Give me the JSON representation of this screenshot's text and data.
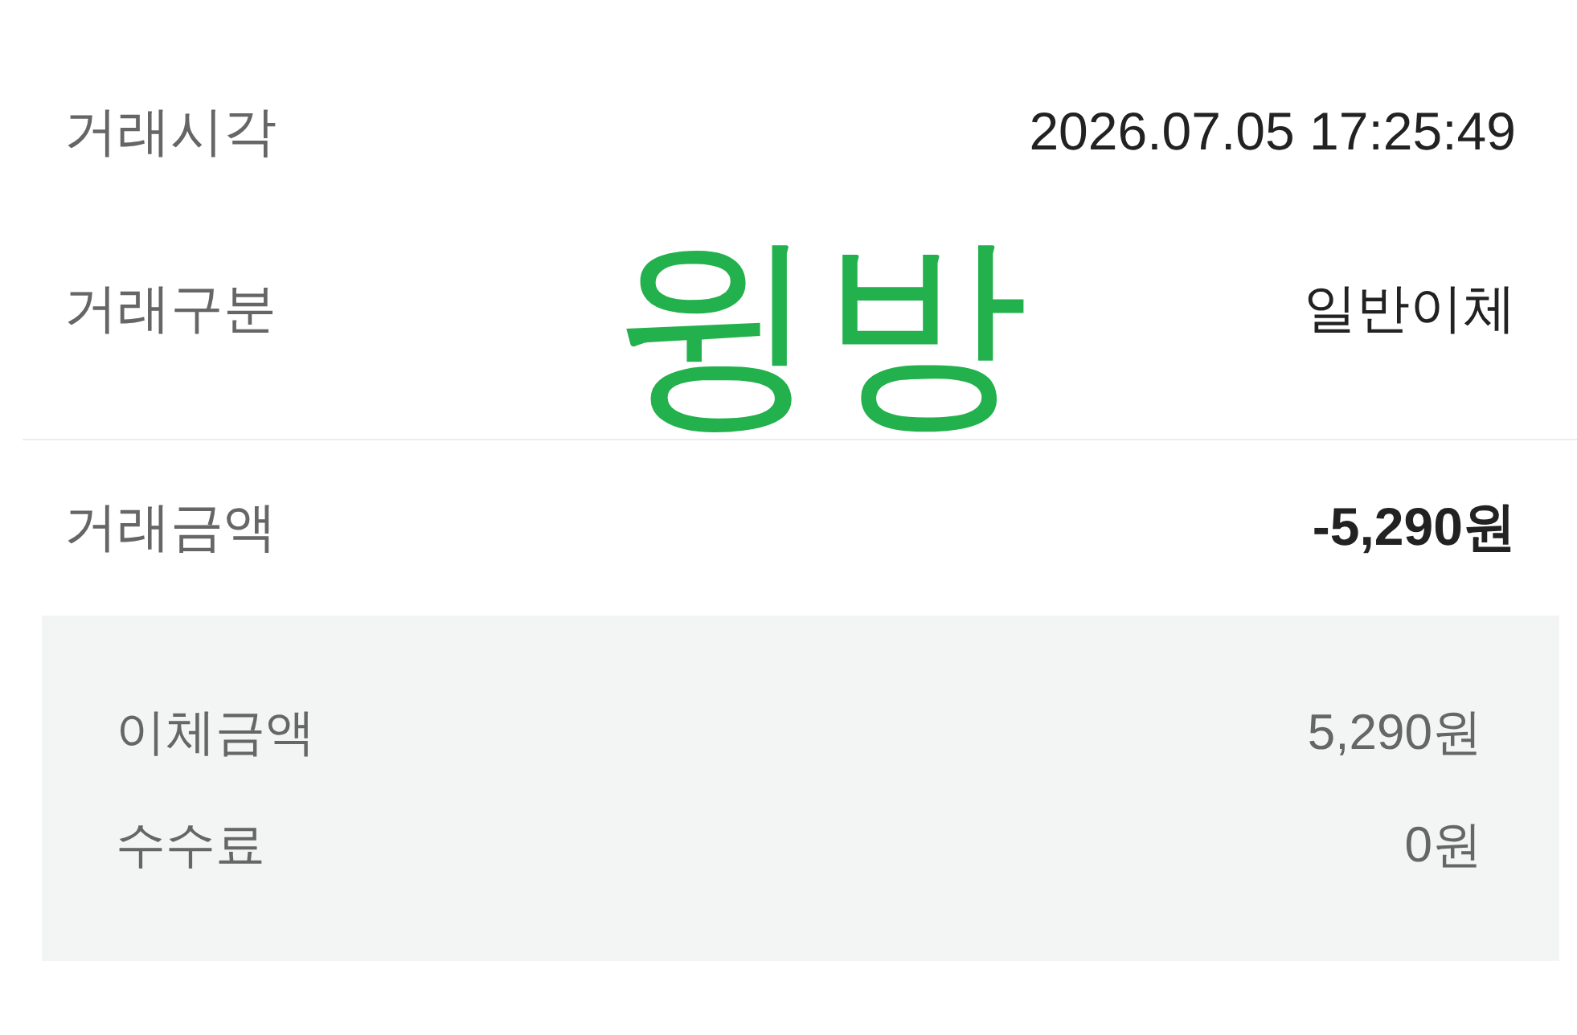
{
  "details": [
    {
      "label": "거래시각",
      "value": "2026.07.05 17:25:49"
    },
    {
      "label": "거래구분",
      "value": "일반이체"
    }
  ],
  "total": {
    "label": "거래금액",
    "value": "-5,290원"
  },
  "breakdown": [
    {
      "label": "이체금액",
      "value": "5,290원"
    },
    {
      "label": "수수료",
      "value": "0원"
    }
  ],
  "handwritten_note": "윙방"
}
